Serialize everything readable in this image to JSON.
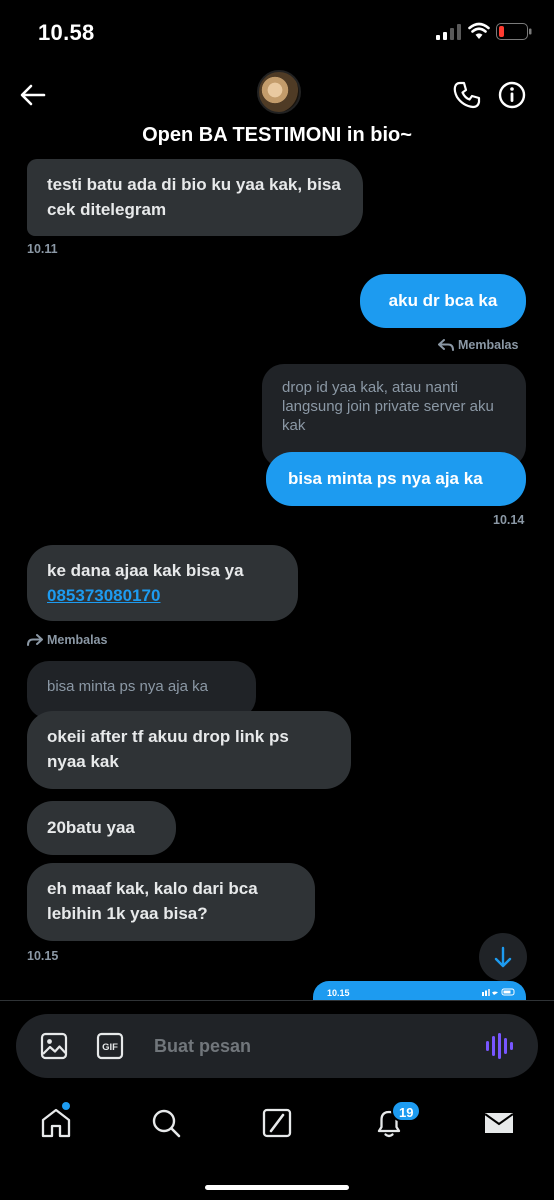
{
  "status_bar": {
    "time": "10.58"
  },
  "header": {
    "title": "Open BA TESTIMONI in bio~"
  },
  "messages": [
    {
      "text": "testi batu ada di bio ku yaa kak, bisa cek ditelegram",
      "time": "10.11"
    },
    {
      "text": "aku dr bca ka",
      "reply_label": "Membalas"
    },
    {
      "quoted": "drop id yaa kak, atau nanti langsung join private server aku kak",
      "text": "bisa minta ps nya aja ka",
      "time": "10.14"
    },
    {
      "text": "ke dana ajaa kak bisa ya",
      "phone": "085373080170",
      "reply_label": "Membalas"
    },
    {
      "quoted": "bisa minta ps nya aja ka",
      "text": "okeii after tf akuu drop link ps nyaa kak"
    },
    {
      "text": "20batu yaa"
    },
    {
      "text": "eh maaf kak, kalo dari bca lebihin 1k yaa bisa?",
      "time": "10.15"
    }
  ],
  "preview_bubble": {
    "time": "10.15"
  },
  "composer": {
    "placeholder": "Buat pesan",
    "gif_label": "GIF"
  },
  "nav": {
    "notification_count": "19"
  },
  "colors": {
    "accent": "#1d9bf0",
    "incoming_bubble": "#2f3336",
    "background": "#000000"
  }
}
